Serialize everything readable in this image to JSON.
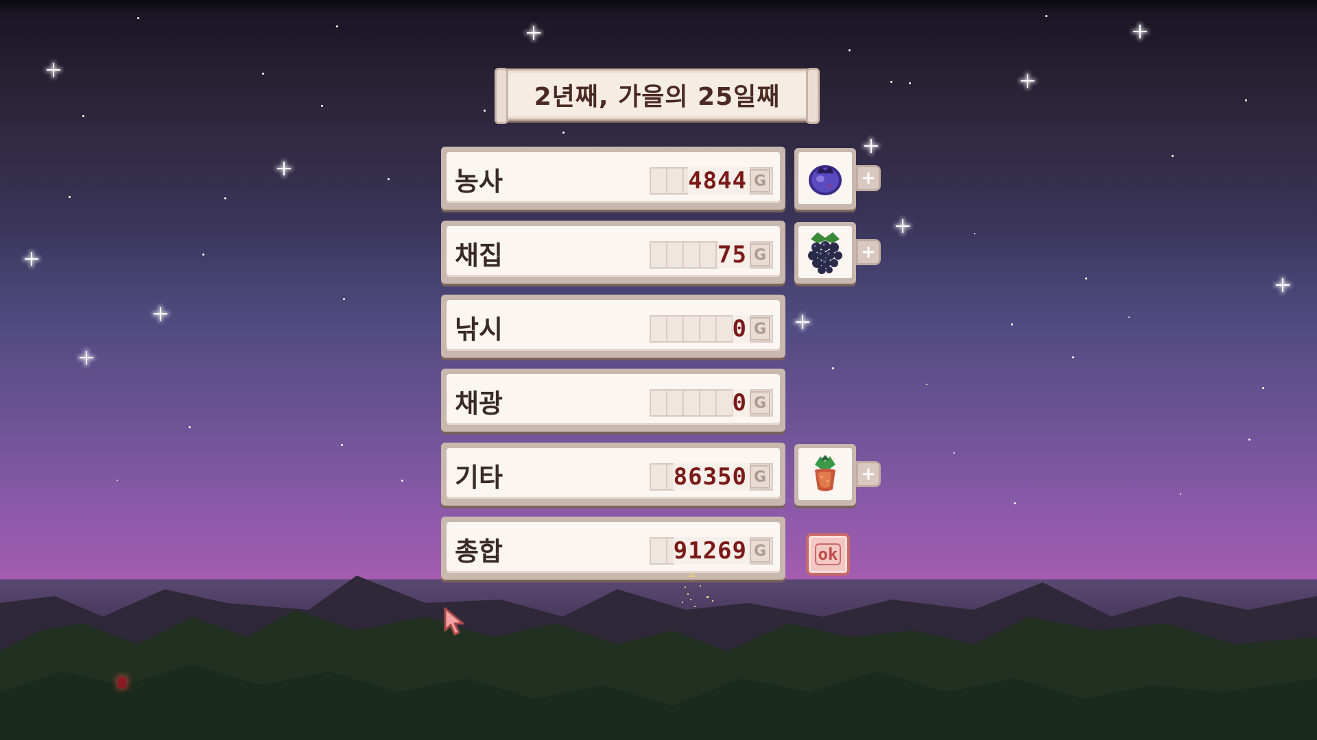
{
  "title": "2년째, 가을의 25일째",
  "currency_symbol": "G",
  "rows": [
    {
      "label": "농사",
      "value": "4844",
      "item_icon": "blueberry-icon"
    },
    {
      "label": "채집",
      "value": "75",
      "item_icon": "blackberry-icon"
    },
    {
      "label": "낚시",
      "value": "0",
      "item_icon": ""
    },
    {
      "label": "채광",
      "value": "0",
      "item_icon": ""
    },
    {
      "label": "기타",
      "value": "86350",
      "item_icon": "seed-pot-icon"
    },
    {
      "label": "총합",
      "value": "91269",
      "item_icon": ""
    }
  ],
  "ok_button": {
    "label": "ok"
  },
  "plus_label": "+",
  "colors": {
    "value_text": "#7a1a18",
    "panel_bg": "#fbf6f1",
    "panel_border": "#c9b8ae",
    "ok_border": "#c86a6a"
  }
}
